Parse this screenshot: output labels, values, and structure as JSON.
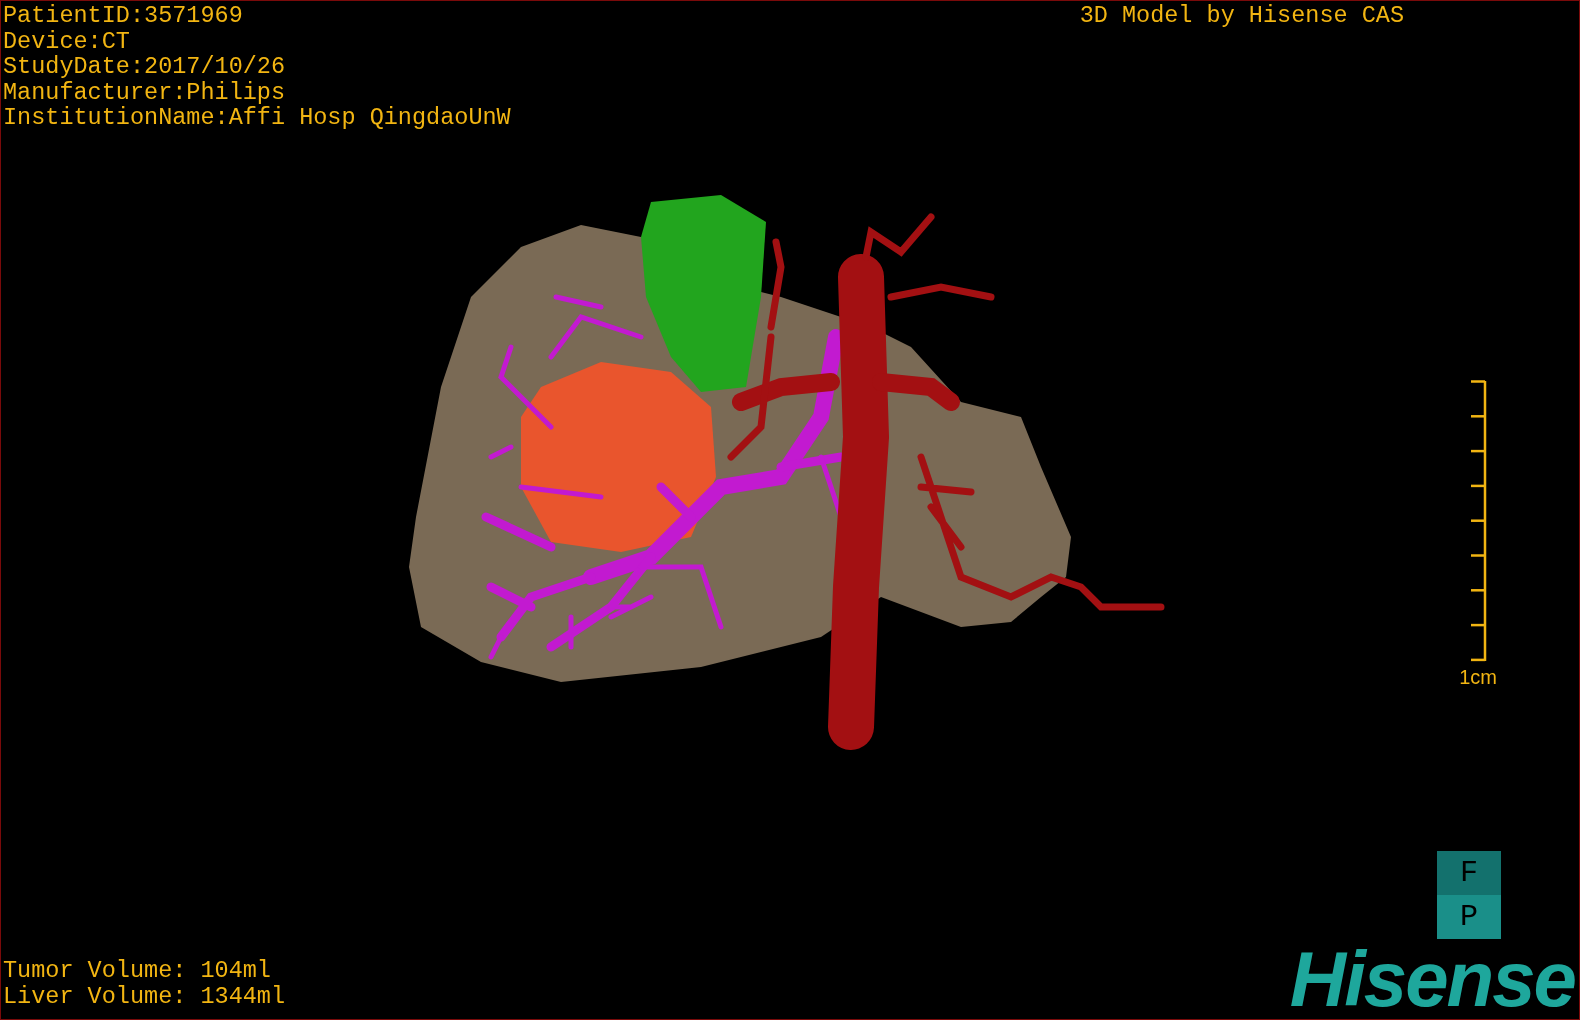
{
  "patient_info": [
    "PatientID:3571969",
    "Device:CT",
    "StudyDate:2017/10/26",
    "Manufacturer:Philips",
    "InstitutionName:Affi Hosp QingdaoUnW"
  ],
  "model_title": "3D Model by Hisense CAS",
  "scale_bar": {
    "label": "1cm"
  },
  "volumes": [
    "Tumor Volume: 104ml",
    "Liver Volume: 1344ml"
  ],
  "orientation": [
    "F",
    "P"
  ],
  "logo": "Hisense"
}
